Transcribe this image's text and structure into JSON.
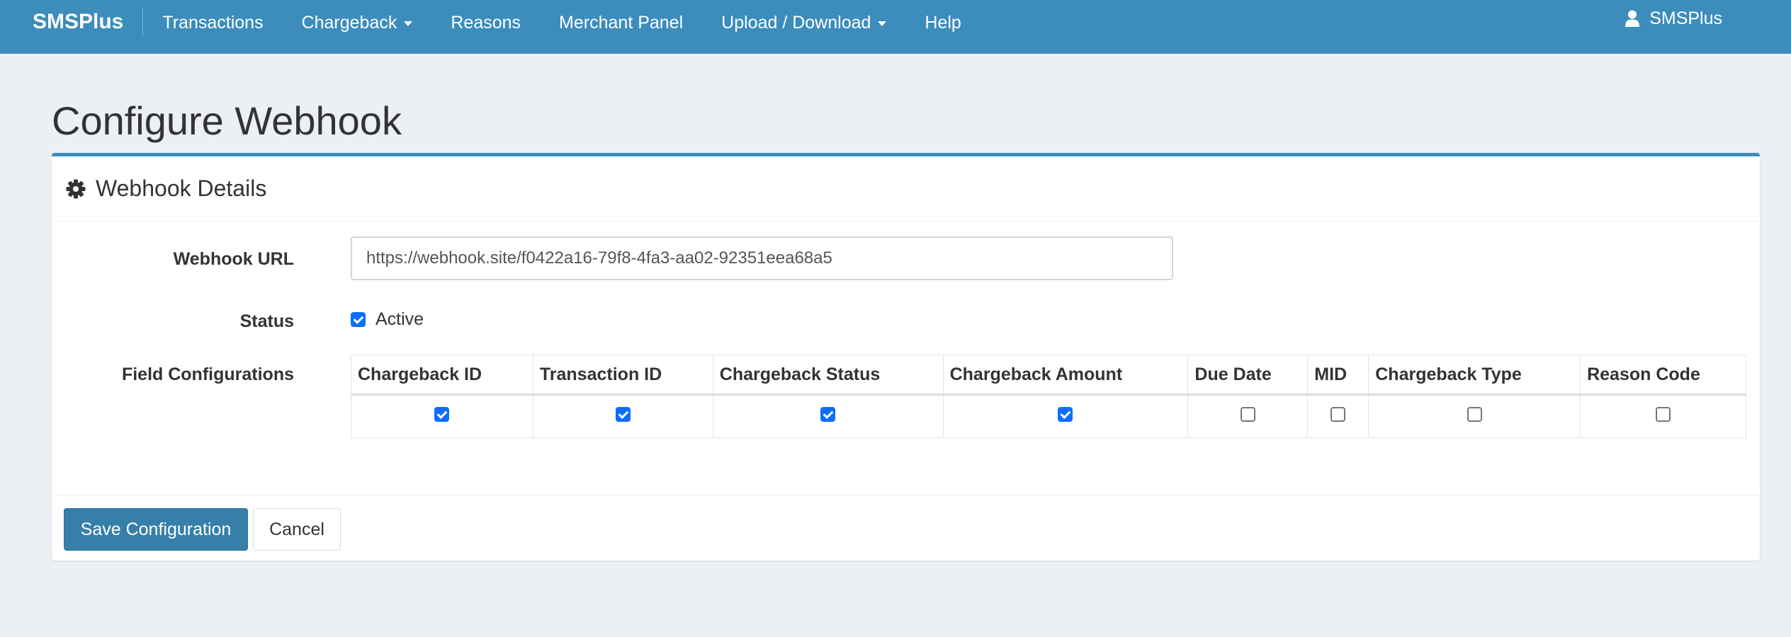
{
  "navbar": {
    "brand": "SMSPlus",
    "items": [
      {
        "label": "Transactions",
        "dropdown": false
      },
      {
        "label": "Chargeback",
        "dropdown": true
      },
      {
        "label": "Reasons",
        "dropdown": false
      },
      {
        "label": "Merchant Panel",
        "dropdown": false
      },
      {
        "label": "Upload / Download",
        "dropdown": true
      },
      {
        "label": "Help",
        "dropdown": false
      }
    ],
    "user": {
      "label": "SMSPlus",
      "icon": "user-icon"
    }
  },
  "page": {
    "title": "Configure Webhook"
  },
  "box": {
    "title": "Webhook Details",
    "icon": "gear-icon",
    "webhook_url": {
      "label": "Webhook URL",
      "value": "https://webhook.site/f0422a16-79f8-4fa3-aa02-92351eea68a5"
    },
    "status": {
      "label": "Status",
      "checkbox_label": "Active",
      "checked": true
    },
    "fields": {
      "label": "Field Configurations",
      "columns": [
        {
          "name": "Chargeback ID",
          "checked": true
        },
        {
          "name": "Transaction ID",
          "checked": true
        },
        {
          "name": "Chargeback Status",
          "checked": true
        },
        {
          "name": "Chargeback Amount",
          "checked": true
        },
        {
          "name": "Due Date",
          "checked": false
        },
        {
          "name": "MID",
          "checked": false
        },
        {
          "name": "Chargeback Type",
          "checked": false
        },
        {
          "name": "Reason Code",
          "checked": false
        }
      ]
    },
    "footer": {
      "save_label": "Save Configuration",
      "cancel_label": "Cancel"
    }
  },
  "colors": {
    "navbar": "#3c8dbc",
    "primary_button": "#367fa9",
    "page_bg": "#ecf0f5",
    "checkbox": "#0d6efd"
  }
}
